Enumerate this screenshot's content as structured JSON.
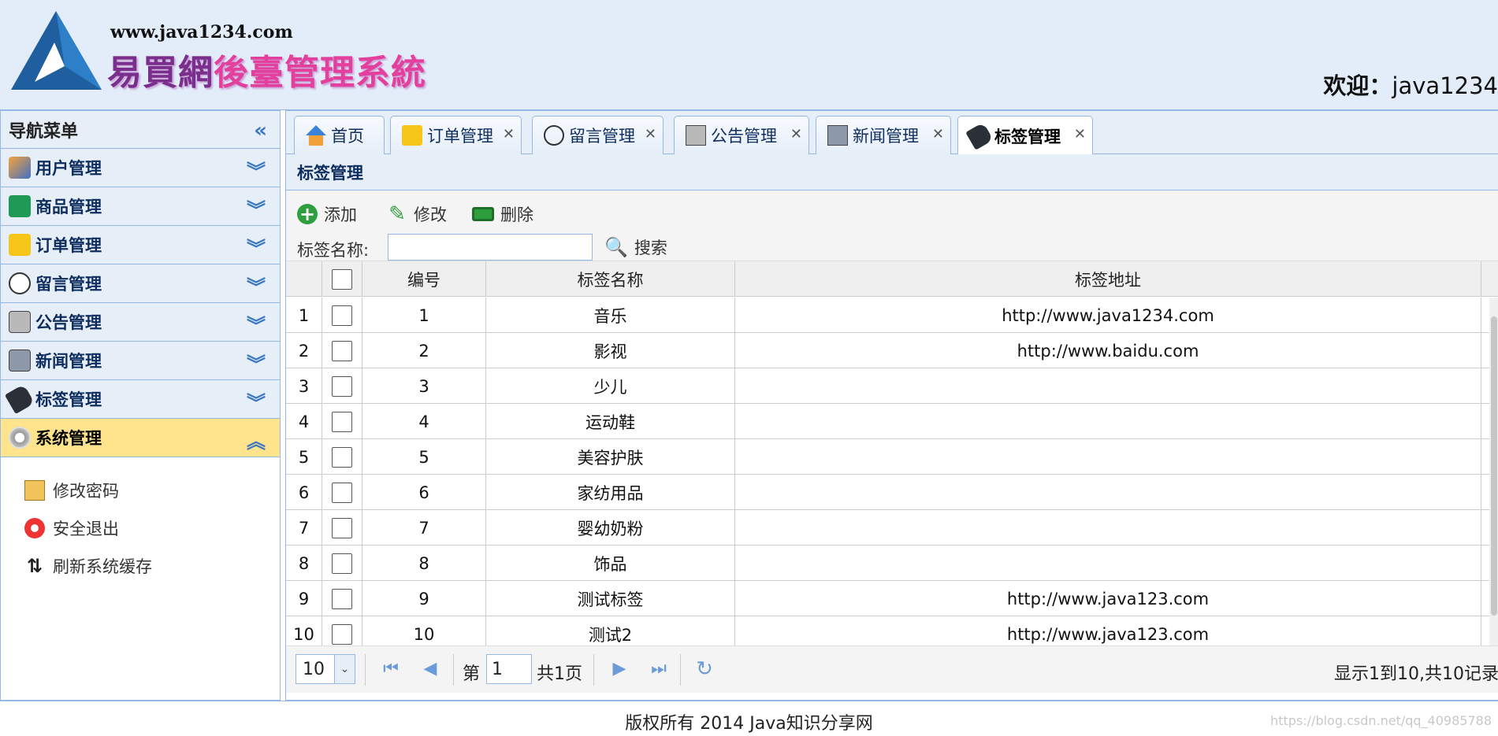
{
  "header": {
    "url": "www.java1234.com",
    "title_part1": "易買網",
    "title_part2": "後臺管理系統",
    "welcome_label": "欢迎：",
    "welcome_user": "java1234"
  },
  "sidebar": {
    "title": "导航菜单",
    "items": [
      {
        "label": "用户管理",
        "icon": "users-icon"
      },
      {
        "label": "商品管理",
        "icon": "list-icon"
      },
      {
        "label": "订单管理",
        "icon": "order-icon"
      },
      {
        "label": "留言管理",
        "icon": "speech-icon"
      },
      {
        "label": "公告管理",
        "icon": "notice-icon"
      },
      {
        "label": "新闻管理",
        "icon": "news-icon"
      },
      {
        "label": "标签管理",
        "icon": "tag-icon"
      },
      {
        "label": "系统管理",
        "icon": "gear-icon"
      }
    ],
    "sub_items": [
      {
        "label": "修改密码",
        "icon": "edit-password-icon"
      },
      {
        "label": "安全退出",
        "icon": "logout-icon"
      },
      {
        "label": "刷新系统缓存",
        "icon": "refresh-cache-icon"
      }
    ]
  },
  "tabs": [
    {
      "label": "首页",
      "icon": "home-icon"
    },
    {
      "label": "订单管理",
      "icon": "order-icon"
    },
    {
      "label": "留言管理",
      "icon": "speech-icon"
    },
    {
      "label": "公告管理",
      "icon": "notice-icon"
    },
    {
      "label": "新闻管理",
      "icon": "news-icon"
    },
    {
      "label": "标签管理",
      "icon": "tag-icon"
    }
  ],
  "panel": {
    "title": "标签管理"
  },
  "toolbar": {
    "add": "添加",
    "edit": "修改",
    "delete": "删除",
    "search_label": "标签名称:",
    "search_value": "",
    "search_button": "搜索"
  },
  "grid": {
    "columns": [
      "编号",
      "标签名称",
      "标签地址"
    ],
    "rows": [
      {
        "n": "1",
        "id": "1",
        "name": "音乐",
        "url": "http://www.java1234.com"
      },
      {
        "n": "2",
        "id": "2",
        "name": "影视",
        "url": "http://www.baidu.com"
      },
      {
        "n": "3",
        "id": "3",
        "name": "少儿",
        "url": ""
      },
      {
        "n": "4",
        "id": "4",
        "name": "运动鞋",
        "url": ""
      },
      {
        "n": "5",
        "id": "5",
        "name": "美容护肤",
        "url": ""
      },
      {
        "n": "6",
        "id": "6",
        "name": "家纺用品",
        "url": ""
      },
      {
        "n": "7",
        "id": "7",
        "name": "婴幼奶粉",
        "url": ""
      },
      {
        "n": "8",
        "id": "8",
        "name": "饰品",
        "url": ""
      },
      {
        "n": "9",
        "id": "9",
        "name": "测试标签",
        "url": "http://www.java123.com"
      },
      {
        "n": "10",
        "id": "10",
        "name": "测试2",
        "url": "http://www.java123.com"
      }
    ]
  },
  "pager": {
    "page_size": "10",
    "page_prefix": "第",
    "page_value": "1",
    "page_total": "共1页",
    "info": "显示1到10,共10记录"
  },
  "footer": {
    "text": "版权所有 2014 Java知识分享网",
    "watermark": "https://blog.csdn.net/qq_40985788"
  },
  "colors": {
    "accent": "#95b8e7",
    "panel_bg": "#e6eef8",
    "active_nav": "#ffe48d"
  }
}
